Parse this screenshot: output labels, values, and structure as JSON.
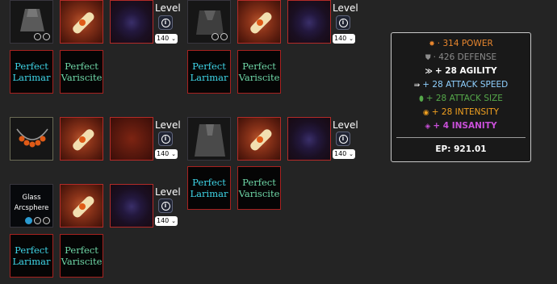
{
  "builds": [
    {
      "level": {
        "label": "Level",
        "value": "140"
      },
      "gems": [
        {
          "line1": "Perfect",
          "line2": "Larimar"
        },
        {
          "line1": "Perfect",
          "line2": "Variscite"
        }
      ]
    },
    {
      "level": {
        "label": "Level",
        "value": "140"
      },
      "gems": [
        {
          "line1": "Perfect",
          "line2": "Larimar"
        },
        {
          "line1": "Perfect",
          "line2": "Variscite"
        }
      ]
    },
    {
      "level": {
        "label": "Level",
        "value": "140"
      },
      "gems": []
    },
    {
      "level": {
        "label": "Level",
        "value": "140"
      },
      "gems": [
        {
          "line1": "Perfect",
          "line2": "Larimar"
        },
        {
          "line1": "Perfect",
          "line2": "Variscite"
        }
      ]
    },
    {
      "item_name": {
        "line1": "Glass",
        "line2": "Arcsphere"
      },
      "level": {
        "label": "Level",
        "value": "140"
      },
      "gems": [
        {
          "line1": "Perfect",
          "line2": "Larimar"
        },
        {
          "line1": "Perfect",
          "line2": "Variscite"
        }
      ]
    }
  ],
  "info_icon": "info-icon",
  "stats": [
    {
      "icon": "power-icon",
      "text": "· 314 POWER",
      "color": "#e8862e"
    },
    {
      "icon": "defense-icon",
      "text": "· 426 DEFENSE",
      "color": "#8c8c8c"
    },
    {
      "icon": "agility-icon",
      "text": "+ 28 AGILITY",
      "color": "#ffffff"
    },
    {
      "icon": "attack-speed-icon",
      "text": "+ 28 ATTACK SPEED",
      "color": "#8fd0ff"
    },
    {
      "icon": "attack-size-icon",
      "text": "+ 28 ATTACK SIZE",
      "color": "#55a84a"
    },
    {
      "icon": "intensity-icon",
      "text": "+ 28 INTENSITY",
      "color": "#f0a020"
    },
    {
      "icon": "insanity-icon",
      "text": "+ 4 INSANITY",
      "color": "#c84fd8"
    }
  ],
  "ep": "EP: 921.01"
}
